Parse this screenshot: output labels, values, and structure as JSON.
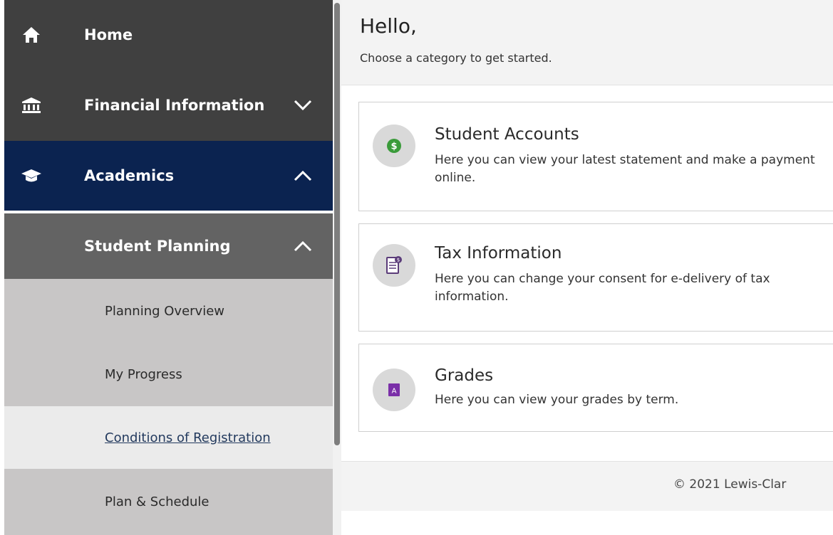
{
  "sidebar": {
    "items": [
      {
        "label": "Home",
        "icon": "home-icon"
      },
      {
        "label": "Financial Information",
        "icon": "bank-icon",
        "chevron": "chevron-down-icon"
      },
      {
        "label": "Academics",
        "icon": "graduation-cap-icon",
        "chevron": "chevron-up-icon"
      },
      {
        "label": "Student Planning",
        "chevron": "chevron-up-icon"
      }
    ],
    "subitems": [
      {
        "label": "Planning Overview"
      },
      {
        "label": "My Progress"
      },
      {
        "label": "Conditions of Registration"
      },
      {
        "label": "Plan & Schedule"
      }
    ]
  },
  "header": {
    "greeting": "Hello,",
    "subtitle": "Choose a category to get started."
  },
  "cards": [
    {
      "title": "Student Accounts",
      "description": "Here you can view your latest statement and make a payment online.",
      "icon": "dollar-coin-icon"
    },
    {
      "title": "Tax Information",
      "description": "Here you can change your consent for e-delivery of tax information.",
      "icon": "tax-document-icon"
    },
    {
      "title": "Grades",
      "description": "Here you can view your grades by term.",
      "icon": "grade-a-icon"
    }
  ],
  "footer": {
    "copyright": "© 2021 Lewis-Clar"
  },
  "colors": {
    "nav_dark": "#404040",
    "nav_active": "#0b2350",
    "nav_sub_header": "#636363",
    "nav_sub": "#c8c6c6",
    "dollar_green": "#3a9b3a",
    "tax_purple": "#5b3c7a",
    "grade_purple": "#7a2fa8"
  }
}
